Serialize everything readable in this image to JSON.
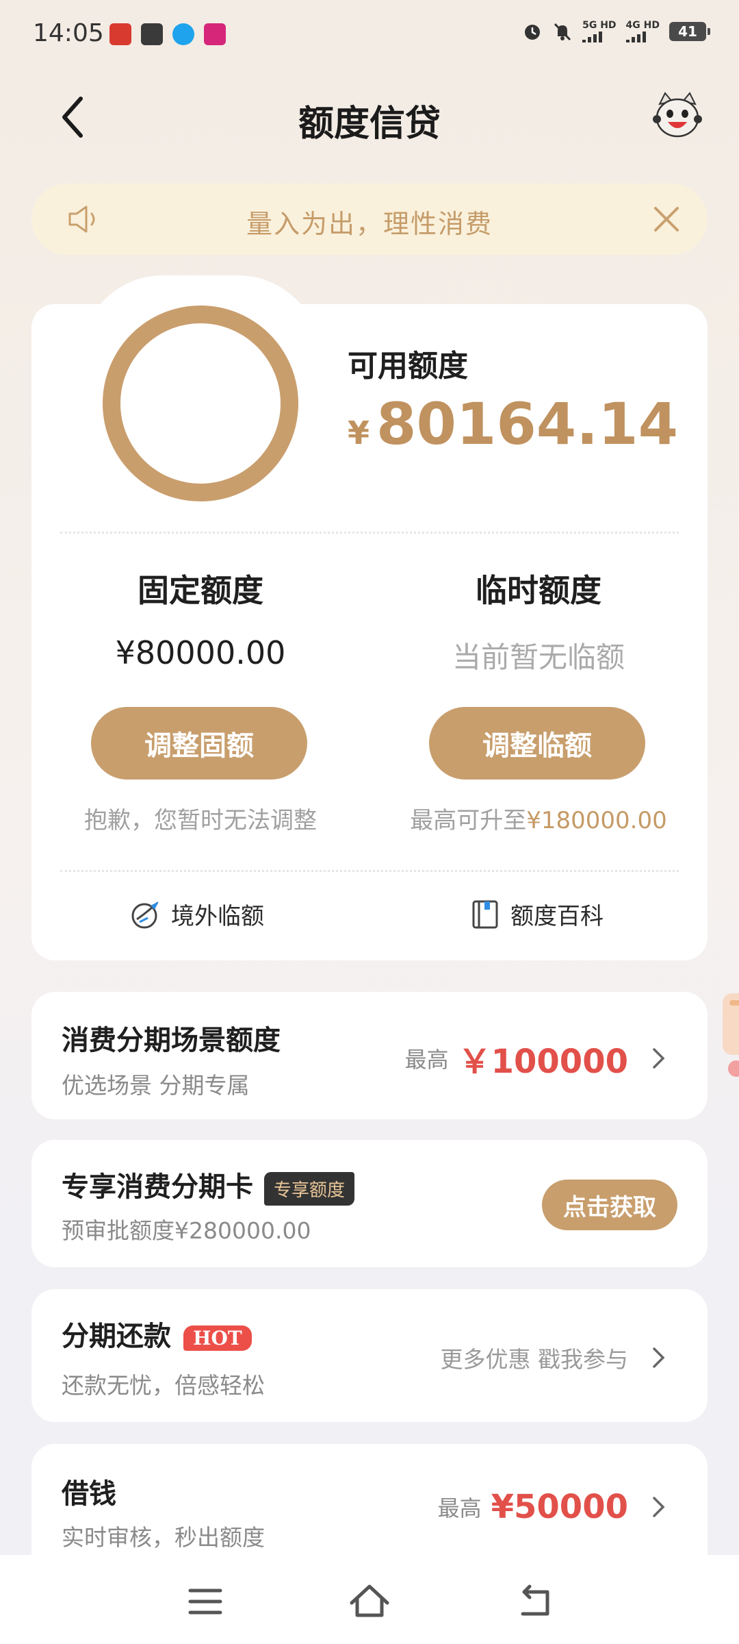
{
  "status_bar": {
    "time": "14:05",
    "net1": "5G HD",
    "net2": "4G HD",
    "battery": "41"
  },
  "nav": {
    "title": "额度信贷"
  },
  "notice": {
    "text": "量入为出，理性消费"
  },
  "credit": {
    "available_label": "可用额度",
    "currency": "¥",
    "available_amount": "80164.14",
    "fixed": {
      "title": "固定额度",
      "value": "¥80000.00",
      "button": "调整固额",
      "note": "抱歉，您暂时无法调整"
    },
    "temp": {
      "title": "临时额度",
      "value": "当前暂无临额",
      "button": "调整临额",
      "note_prefix": "最高可升至",
      "note_amount": "¥180000.00"
    },
    "links": {
      "overseas": "境外临额",
      "wiki": "额度百科"
    }
  },
  "cards": {
    "installment_scene": {
      "title": "消费分期场景额度",
      "subtitle": "优选场景 分期专属",
      "max_label": "最高",
      "max_amount": "￥100000"
    },
    "exclusive_card": {
      "title": "专享消费分期卡",
      "tag": "专享额度",
      "subtitle": "预审批额度¥280000.00",
      "button": "点击获取"
    },
    "installment_repay": {
      "title": "分期还款",
      "tag": "HOT",
      "subtitle": "还款无忧，倍感轻松",
      "right_text": "更多优惠 戳我参与"
    },
    "borrow": {
      "title": "借钱",
      "subtitle": "实时审核，秒出额度",
      "max_label": "最高",
      "max_amount": "¥50000"
    }
  },
  "colors": {
    "accent_gold": "#c89e6d",
    "highlight_red": "#e2504a",
    "notice_bg": "#faf1dc"
  }
}
